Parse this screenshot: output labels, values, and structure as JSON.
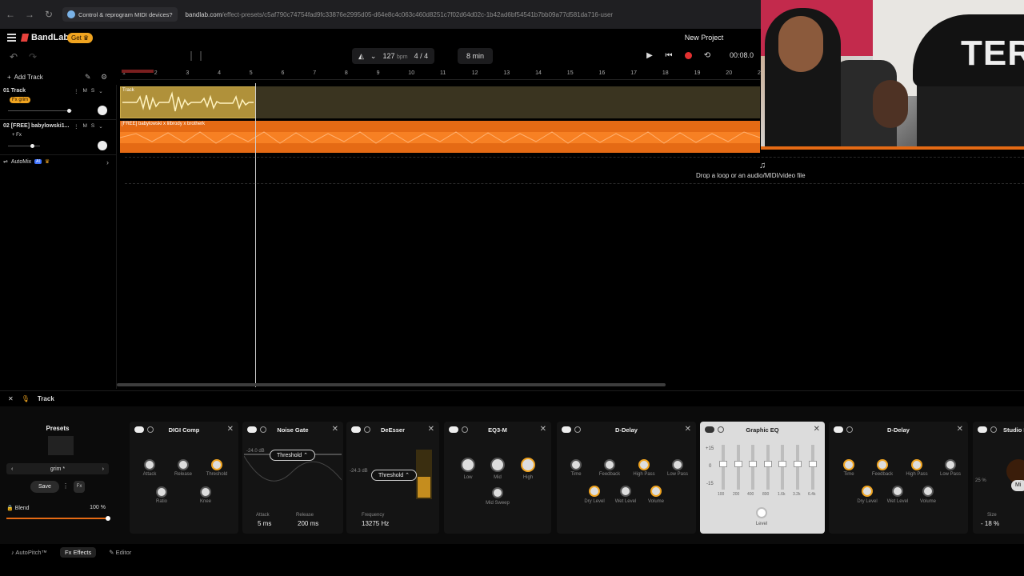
{
  "browser": {
    "extension_label": "Control & reprogram MIDI devices?",
    "url_host": "bandlab.com",
    "url_path": "/effect-presets/c5af790c74754fad9fc33876e2995d05-d64e8c4c063c460d8251c7f02d64d02c-1b42ad6bf54541b7bb09a77d581da716-user"
  },
  "header": {
    "brand": "BandLab",
    "get_label": "Get",
    "project_title": "New Project"
  },
  "toolbar": {
    "tempo": "127",
    "tempo_unit": "bpm",
    "time_signature": "4 / 4",
    "length": "8 min",
    "timecode": "00:08.0"
  },
  "timeline": {
    "add_track_label": "Add Track",
    "ruler_ticks": [
      "1",
      "2",
      "3",
      "4",
      "5",
      "6",
      "7",
      "8",
      "9",
      "10",
      "11",
      "12",
      "13",
      "14",
      "15",
      "16",
      "17",
      "18",
      "19",
      "20",
      "2"
    ],
    "drop_hint": "Drop a loop or an audio/MIDI/video file",
    "tracks": [
      {
        "index_label": "01 Track",
        "fx_badge": "Fx grim",
        "clip_label": "Track",
        "mute": "M",
        "solo": "S"
      },
      {
        "index_label": "02 [FREE] babylowski1...",
        "fx_badge": "+ Fx",
        "clip_label": "[FREE] babylowski x lilbrody x brotherk",
        "mute": "M",
        "solo": "S"
      }
    ],
    "automix_label": "AutoMix",
    "automix_badge": "AI"
  },
  "fx_panel": {
    "track_name": "Track",
    "presets": {
      "title": "Presets",
      "current": "grim *",
      "save_label": "Save",
      "blend_label": "Blend",
      "blend_value": "100 %",
      "blend_level": 1.0
    },
    "effects": [
      {
        "name": "DIGI Comp",
        "knobs": [
          "Attack",
          "Release",
          "Threshold",
          "Ratio",
          "Knee"
        ]
      },
      {
        "name": "Noise Gate",
        "threshold_btn": "Threshold",
        "db": "-24.0 dB",
        "attack_label": "Attack",
        "attack_value": "5 ms",
        "release_label": "Release",
        "release_value": "200 ms"
      },
      {
        "name": "DeEsser",
        "threshold_btn": "Threshold",
        "db": "-24.3 dB",
        "freq_label": "Frequency",
        "freq_value": "13275 Hz"
      },
      {
        "name": "EQ3-M",
        "knobs": [
          "Low",
          "Mid",
          "High",
          "Mid Sweep"
        ]
      },
      {
        "name": "D-Delay",
        "knobs": [
          "Time",
          "Feedback",
          "High Pass",
          "Low Pass",
          "Dry Level",
          "Wet Level",
          "Volume"
        ]
      },
      {
        "name": "Graphic EQ",
        "db_labels": [
          "+15",
          "0",
          "-15"
        ],
        "bands": [
          "100",
          "200",
          "400",
          "800",
          "1.6k",
          "3.2k",
          "6.4k"
        ],
        "level_label": "Level"
      },
      {
        "name": "D-Delay",
        "knobs": [
          "Time",
          "Feedback",
          "High Pass",
          "Low Pass",
          "Dry Level",
          "Wet Level",
          "Volume"
        ]
      },
      {
        "name": "Studio R",
        "size_label": "Size",
        "size_value": "18 %",
        "side_value": "25 %",
        "mix_label": "Mi"
      }
    ]
  },
  "footer": {
    "autopitch": "AutoPitch™",
    "effects": "Effects",
    "editor": "Editor"
  },
  "colors": {
    "accent": "#f0a420",
    "track2": "#e56a14",
    "record": "#e23030"
  }
}
